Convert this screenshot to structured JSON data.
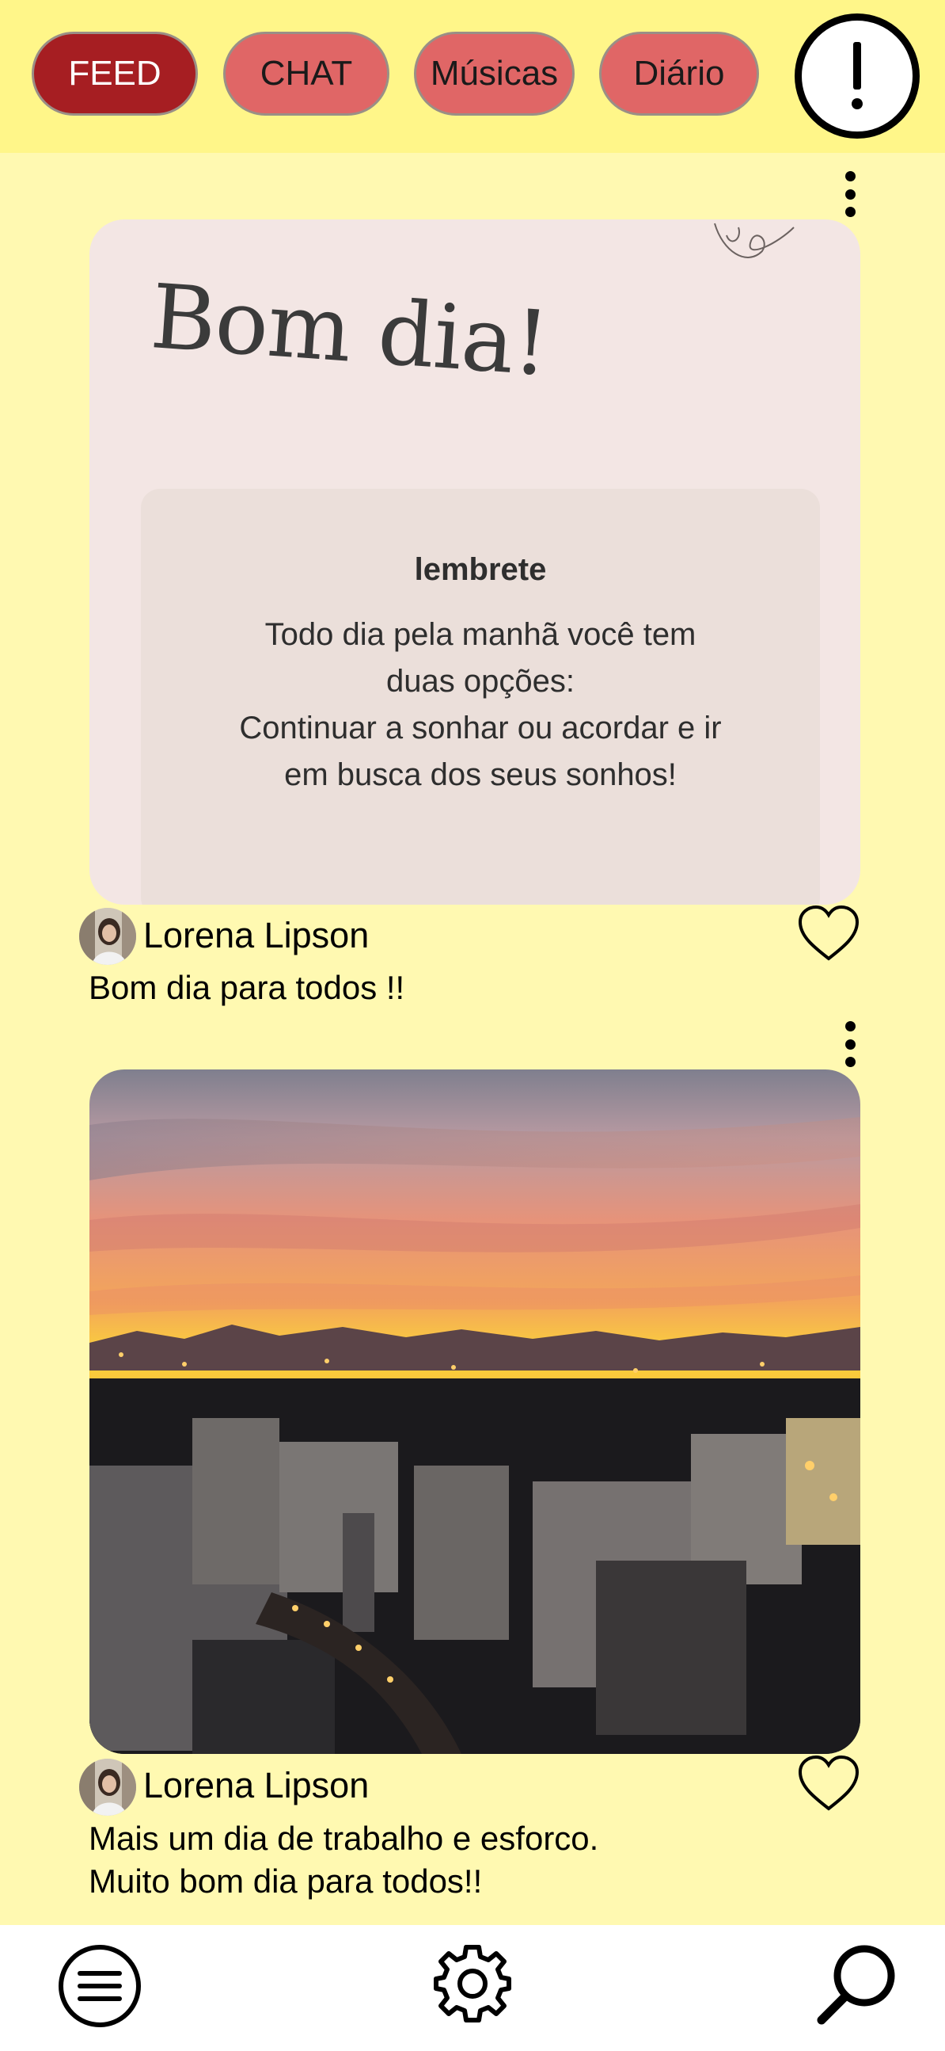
{
  "tabs": [
    {
      "label": "FEED",
      "active": true
    },
    {
      "label": "CHAT",
      "active": false
    },
    {
      "label": "Músicas",
      "active": false
    },
    {
      "label": "Diário",
      "active": false
    }
  ],
  "header": {
    "alert_symbol": "!",
    "alert_icon": "exclamation-icon"
  },
  "posts": [
    {
      "image": {
        "greeting": "Bom dia!",
        "reminder_title": "lembrete",
        "reminder_text": "Todo dia pela manhã você tem\nduas opções:\nContinuar a sonhar ou acordar e ir\nem busca dos seus sonhos!"
      },
      "author": "Lorena Lipson",
      "caption": "Bom dia para todos !!",
      "menu_icon": "more-vertical-icon",
      "like_icon": "heart-icon"
    },
    {
      "image": {
        "description_icon": "sunset-city-photo"
      },
      "author": "Lorena Lipson",
      "caption": "Mais um dia de trabalho e esforco.\nMuito bom dia para todos!!",
      "menu_icon": "more-vertical-icon",
      "like_icon": "heart-icon"
    }
  ],
  "bottom_nav": [
    {
      "icon": "menu-icon"
    },
    {
      "icon": "gear-icon"
    },
    {
      "icon": "search-icon"
    }
  ],
  "colors": {
    "background": "#fff9b1",
    "topbar": "#fff689",
    "tab": "#e06666",
    "tab_active": "#a61e22"
  }
}
